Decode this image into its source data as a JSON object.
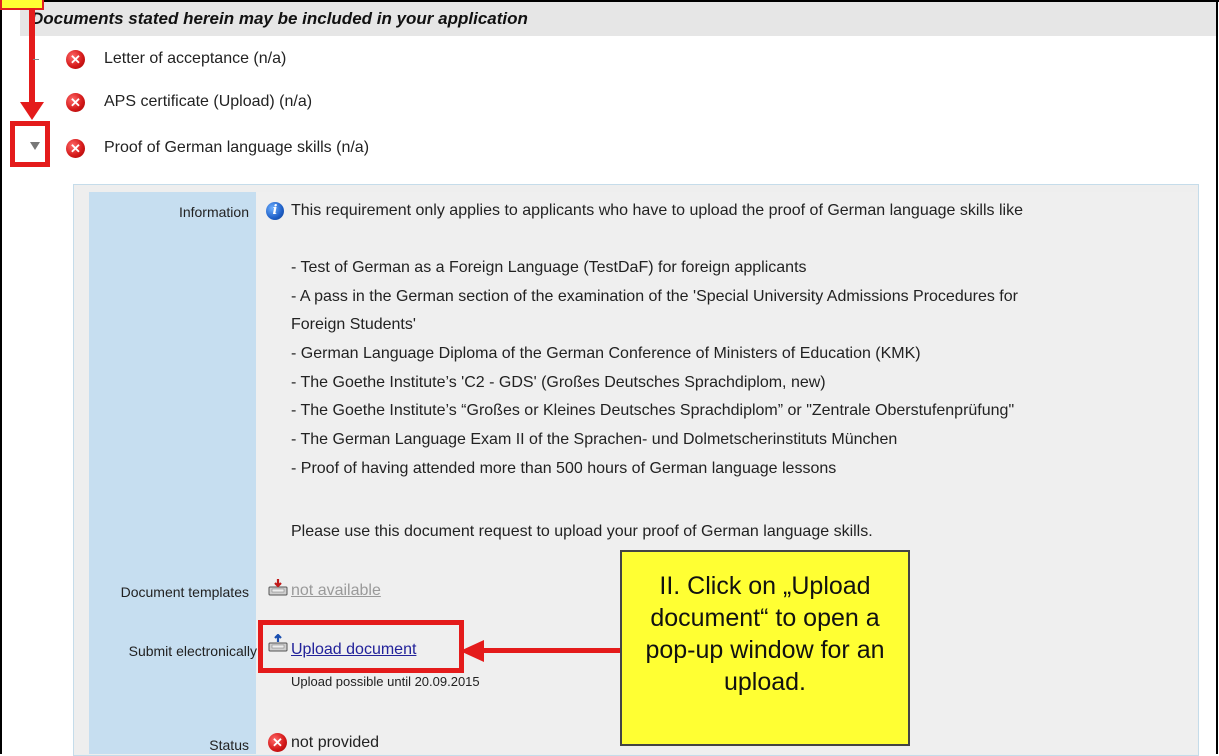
{
  "section_header": "Documents stated herein may be included in your application",
  "requirements": [
    {
      "label": "Letter of acceptance (n/a)"
    },
    {
      "label": "APS certificate (Upload) (n/a)"
    },
    {
      "label": "Proof of German language skills (n/a)"
    }
  ],
  "details": {
    "information_label": "Information",
    "information_intro": "This requirement only applies to applicants who have to upload the proof of German language skills like",
    "information_items": [
      "- Test of German as a Foreign Language (TestDaF) for foreign applicants",
      "- A pass in the German section of the examination of the 'Special University Admissions Procedures for",
      "Foreign Students'",
      "- German Language Diploma of the German Conference of Ministers of Education (KMK)",
      "- The Goethe Institute’s 'C2 - GDS' (Großes Deutsches Sprachdiplom, new)",
      "- The Goethe Institute’s “Großes or Kleines Deutsches Sprachdiplom” or \"Zentrale Oberstufenprüfung\"",
      "- The German Language Exam II of the Sprachen- und Dolmetscherinstituts München",
      "- Proof of having attended more than 500 hours of German language lessons"
    ],
    "information_footer": "Please use this document request to upload your proof of German language skills.",
    "templates_label": "Document templates",
    "templates_value": "not available",
    "submit_label": "Submit electronically",
    "upload_link": "Upload document",
    "upload_deadline": "Upload possible until 20.09.2015",
    "status_label": "Status",
    "status_value": "not provided"
  },
  "callout": "II. Click on „Upload document“ to open a pop-up window for an upload.",
  "colors": {
    "accent_red": "#e41b1b",
    "callout_yellow": "#ffff33",
    "label_blue": "#c6def0",
    "link": "#22229a"
  },
  "icons": [
    "error-x-icon",
    "info-icon",
    "download-tray-icon",
    "upload-tray-icon",
    "collapse-triangle-icon"
  ]
}
